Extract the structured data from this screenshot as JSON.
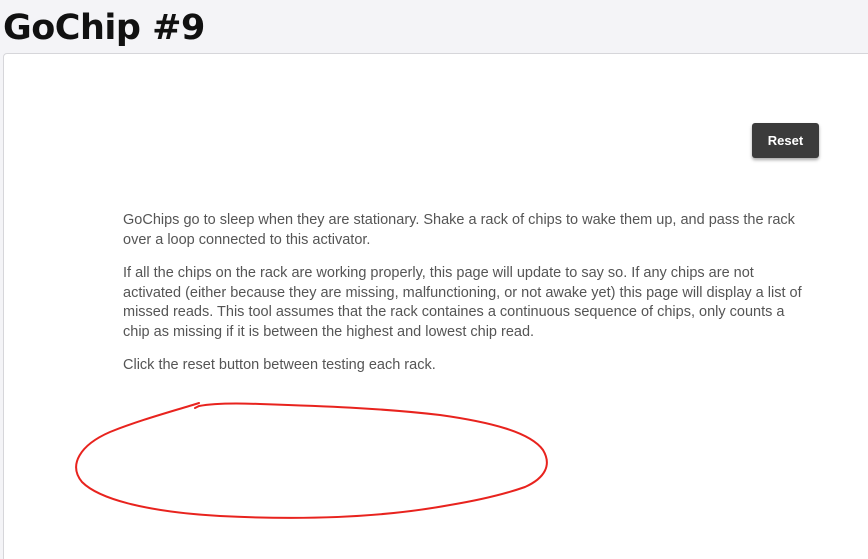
{
  "page": {
    "title": "GoChip #9"
  },
  "toolbar": {
    "reset_label": "Reset"
  },
  "instructions": {
    "paragraphs": [
      "GoChips go to sleep when they are stationary. Shake a rack of chips to wake them up, and pass the rack over a loop connected to this activator.",
      "If all the chips on the rack are working properly, this page will update to say so. If any chips are not activated (either because they are missing, malfunctioning, or not awake yet) this page will display a list of missed reads. This tool assumes that the rack containes a continuous sequence of chips, only counts a chip as missing if it is between the highest and lowest chip read.",
      "Click the reset button between testing each rack."
    ]
  },
  "annotation": {
    "stroke_color": "#e8231e"
  }
}
